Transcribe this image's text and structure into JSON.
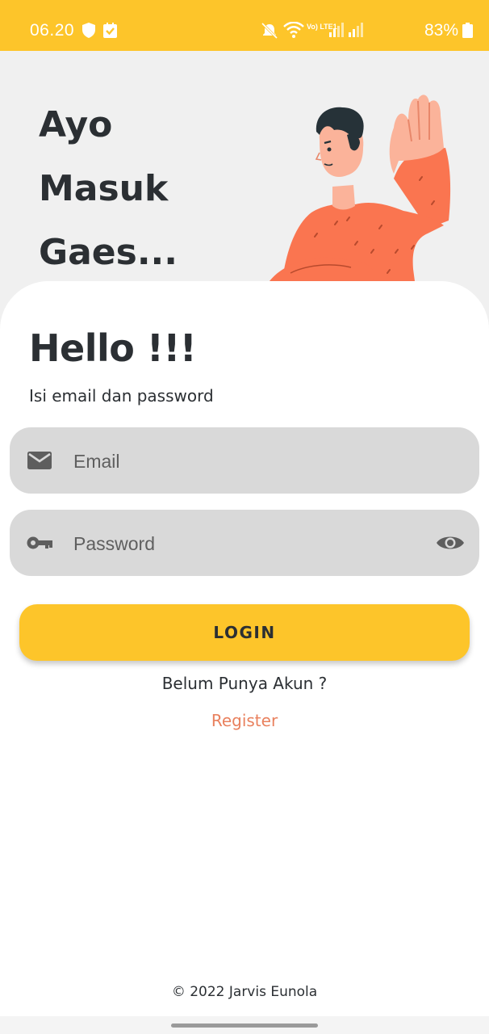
{
  "status_bar": {
    "time": "06.20",
    "battery": "83%",
    "lte_label": "Vo) LTE1",
    "icons": [
      "shield-icon",
      "check-box-icon",
      "mute-icon",
      "wifi-icon",
      "signal-icon",
      "signal-icon-2",
      "battery-icon"
    ]
  },
  "hero": {
    "title_lines": [
      "Ayo",
      "Masuk",
      "Gaes..."
    ],
    "illustration": "waving-man-illustration"
  },
  "login": {
    "heading": "Hello !!!",
    "subtitle": "Isi email dan password",
    "email_placeholder": "Email",
    "email_icon": "mail-icon",
    "password_placeholder": "Password",
    "password_icon": "key-icon",
    "visibility_icon": "eye-icon",
    "button_label": "LOGIN",
    "no_account_text": "Belum Punya Akun ?",
    "register_label": "Register"
  },
  "footer": {
    "copyright": "© 2022 Jarvis Eunola"
  },
  "colors": {
    "accent": "#fdc52a",
    "link": "#e9815e",
    "field_bg": "#d9d9d9",
    "text": "#2b2f33"
  }
}
